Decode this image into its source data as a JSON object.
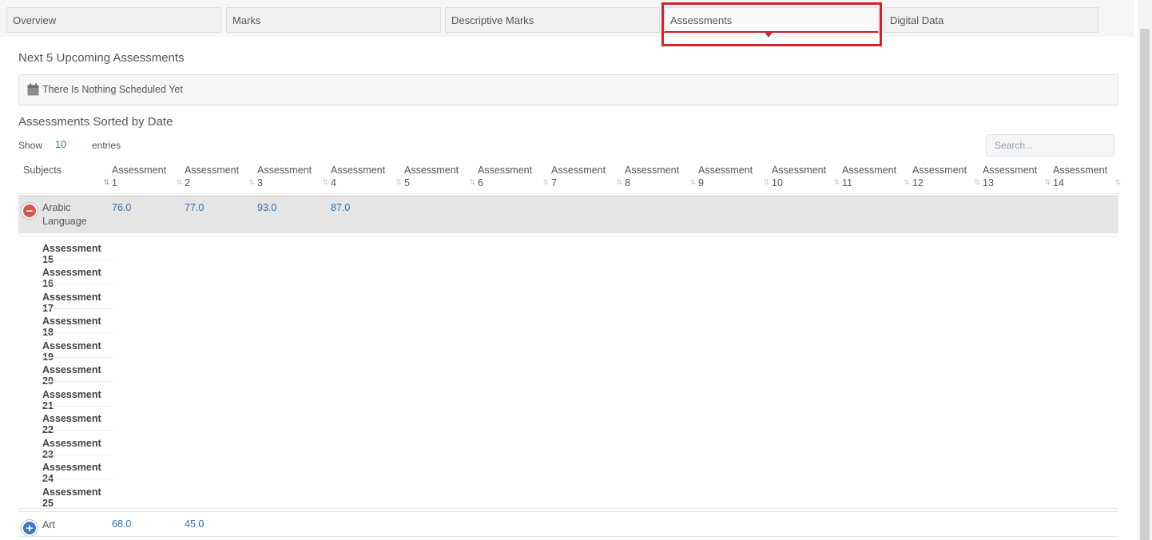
{
  "tabs": [
    {
      "label": "Overview"
    },
    {
      "label": "Marks"
    },
    {
      "label": "Descriptive Marks"
    },
    {
      "label": "Assessments"
    },
    {
      "label": "Digital Data"
    }
  ],
  "active_tab": "Assessments",
  "upcoming": {
    "title": "Next 5 Upcoming Assessments",
    "notice": "There Is Nothing Scheduled Yet"
  },
  "sorted": {
    "title": "Assessments Sorted by Date",
    "show_label": "Show",
    "show_value": "10",
    "entries_label": "entries",
    "search_placeholder": "Search..."
  },
  "table": {
    "columns": [
      {
        "line1": "Subjects",
        "line2": ""
      },
      {
        "line1": "Assessment",
        "line2": "1"
      },
      {
        "line1": "Assessment",
        "line2": "2"
      },
      {
        "line1": "Assessment",
        "line2": "3"
      },
      {
        "line1": "Assessment",
        "line2": "4"
      },
      {
        "line1": "Assessment",
        "line2": "5"
      },
      {
        "line1": "Assessment",
        "line2": "6"
      },
      {
        "line1": "Assessment",
        "line2": "7"
      },
      {
        "line1": "Assessment",
        "line2": "8"
      },
      {
        "line1": "Assessment",
        "line2": "9"
      },
      {
        "line1": "Assessment",
        "line2": "10"
      },
      {
        "line1": "Assessment",
        "line2": "11"
      },
      {
        "line1": "Assessment",
        "line2": "12"
      },
      {
        "line1": "Assessment",
        "line2": "13"
      },
      {
        "line1": "Assessment",
        "line2": "14"
      }
    ],
    "rows": [
      {
        "subject_line1": "Arabic",
        "subject_line2": "Language",
        "values": [
          "76.0",
          "77.0",
          "93.0",
          "87.0"
        ],
        "expanded": true,
        "details": [
          "Assessment 15",
          "Assessment 16",
          "Assessment 17",
          "Assessment 18",
          "Assessment 19",
          "Assessment 20",
          "Assessment 21",
          "Assessment 22",
          "Assessment 23",
          "Assessment 24",
          "Assessment 25"
        ]
      },
      {
        "subject_line1": "Art",
        "subject_line2": "",
        "values": [
          "68.0",
          "45.0"
        ],
        "expanded": false
      }
    ]
  },
  "icons": {
    "calendar": "calendar-icon",
    "expand": "plus-circle-icon",
    "collapse": "minus-circle-icon",
    "sort": "sort-icon"
  },
  "colors": {
    "accent": "#c9242b",
    "link": "#2f6fb0",
    "collapse": "#d9534f",
    "expand": "#3b7bbf"
  }
}
